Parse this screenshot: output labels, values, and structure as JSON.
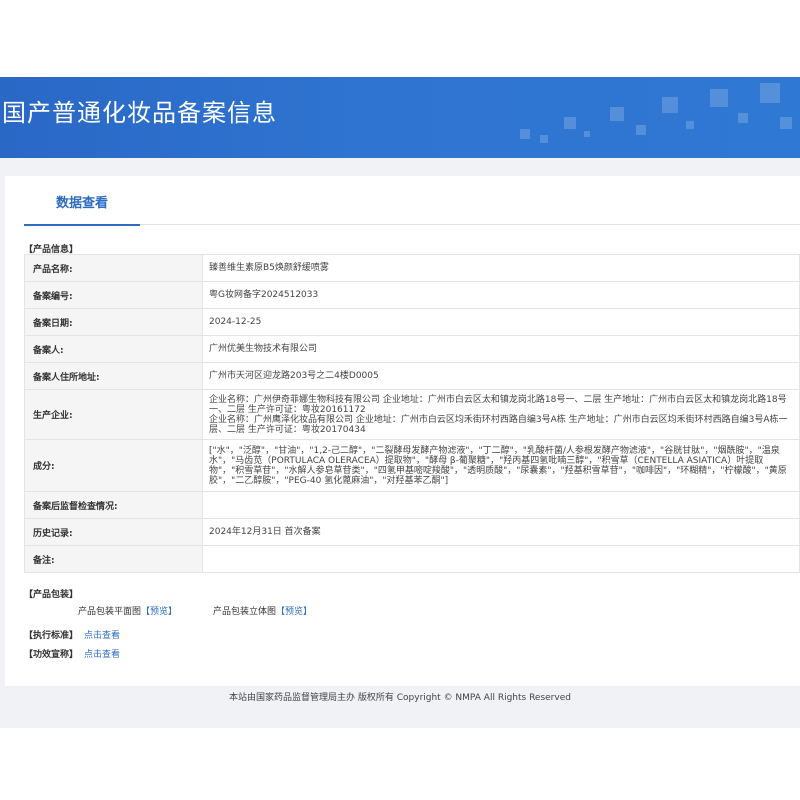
{
  "header": {
    "title": "国产普通化妆品备案信息"
  },
  "tab": {
    "label": "数据查看"
  },
  "product_info": {
    "section_title": "【产品信息】",
    "rows": [
      {
        "label": "产品名称:",
        "value": "臻善维生素原B5焕颜舒缓喷雾"
      },
      {
        "label": "备案编号:",
        "value": "粤G妆网备字2024512033"
      },
      {
        "label": "备案日期:",
        "value": "2024-12-25"
      },
      {
        "label": "备案人:",
        "value": "广州优美生物技术有限公司"
      },
      {
        "label": "备案人住所地址:",
        "value": "广州市天河区迎龙路203号之二4楼D0005"
      },
      {
        "label": "生产企业:",
        "value": "企业名称：广州伊奇菲娜生物科技有限公司 企业地址：广州市白云区太和镇龙岗北路18号一、二层 生产地址：广州市白云区太和镇龙岗北路18号一、二层 生产许可证：粤妆20161172\n企业名称：广州鹰泽化妆品有限公司 企业地址：广州市白云区均禾街环村西路自编3号A栋 生产地址：广州市白云区均禾街环村西路自编3号A栋一层、二层 生产许可证：粤妆20170434"
      },
      {
        "label": "成分:",
        "value": "[\"水\"，\"泛醇\"，\"甘油\"，\"1,2-己二醇\"，\"二裂酵母发酵产物滤液\"，\"丁二醇\"，\"乳酸杆菌/人参根发酵产物滤液\"，\"谷胱甘肽\"，\"烟酰胺\"，\"温泉水\"，\"马齿苋（PORTULACA OLERACEA）提取物\"，\"酵母 β-葡聚糖\"，\"羟丙基四氢吡喃三醇\"，\"积雪草（CENTELLA ASIATICA）叶提取物\"，\"积雪草苷\"，\"水解人参皂草苷类\"，\"四氢甲基嘧啶羧酸\"，\"透明质酸\"，\"尿囊素\"，\"羟基积雪草苷\"，\"咖啡因\"，\"环糊精\"，\"柠檬酸\"，\"黄原胶\"，\"二乙醇胺\"，\"PEG-40 氢化蓖麻油\"，\"对羟基苯乙酮\"]"
      },
      {
        "label": "备案后监督检查情况:",
        "value": ""
      },
      {
        "label": "历史记录:",
        "value": "2024年12月31日 首次备案"
      },
      {
        "label": "备注:",
        "value": ""
      }
    ]
  },
  "packaging": {
    "section_title": "【产品包装】",
    "flat_label": "产品包装平面图",
    "stereo_label": "产品包装立体图",
    "bracket_open": "【",
    "bracket_close": "】",
    "preview_label": "预览"
  },
  "standard": {
    "section_title": "【执行标准】",
    "link_label": "点击查看"
  },
  "efficacy": {
    "section_title": "【功效宣称】",
    "link_label": "点击查看"
  },
  "footer": {
    "text": "本站由国家药品监督管理局主办 版权所有 Copyright © NMPA All Rights Reserved"
  },
  "colors": {
    "header_blue": "#2f74d0",
    "link_blue": "#2d6cc0"
  }
}
